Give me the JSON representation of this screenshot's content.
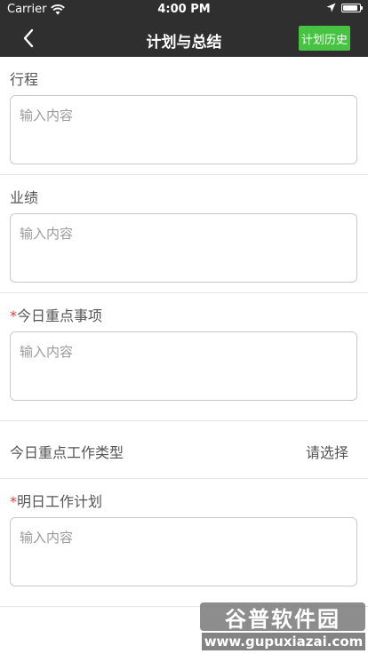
{
  "status_bar": {
    "carrier": "Carrier",
    "time": "4:00 PM",
    "battery_level": 0.9
  },
  "nav": {
    "title": "计划与总结",
    "history_button": "计划历史"
  },
  "sections": [
    {
      "label": "行程",
      "required": false,
      "placeholder": "输入内容"
    },
    {
      "label": "业绩",
      "required": false,
      "placeholder": "输入内容"
    },
    {
      "label": "今日重点事项",
      "required": true,
      "placeholder": "输入内容"
    }
  ],
  "select_row": {
    "label": "今日重点工作类型",
    "value": "请选择"
  },
  "tomorrow": {
    "label": "明日工作计划",
    "required": true,
    "placeholder": "输入内容"
  },
  "required_mark": "*",
  "watermark": {
    "title": "谷普软件园",
    "url": "www.gupuxiazai.com"
  },
  "colors": {
    "nav_bg": "#2f2f2f",
    "accent_green": "#46c441",
    "required_red": "#e23a3a"
  }
}
